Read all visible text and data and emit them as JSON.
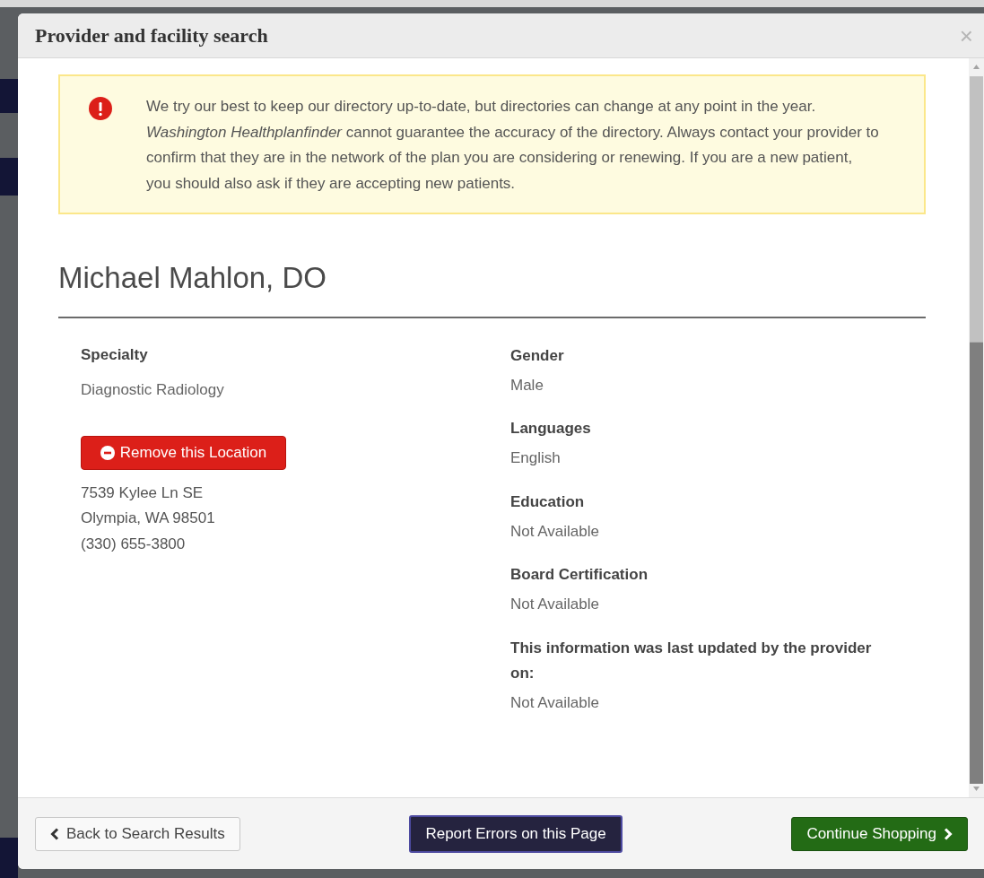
{
  "dialog": {
    "title": "Provider and facility search",
    "close": "×"
  },
  "notice": {
    "text": "We try our best to keep our directory up-to-date, but directories can change at any point in the year. *Washington Healthplanfinder* cannot guarantee the accuracy of the directory. Always contact your provider to confirm that they are in the network of the plan you are considering or renewing. If you are a new patient, you should also ask if they are accepting new patients."
  },
  "provider": {
    "name": "Michael Mahlon, DO",
    "left_fields": [
      {
        "label": "Specialty",
        "value": "Diagnostic Radiology"
      }
    ],
    "remove_button": "Remove this Location",
    "address": [
      "7539 Kylee Ln SE",
      "Olympia, WA 98501",
      "(330) 655-3800"
    ],
    "right_fields": [
      {
        "label": "Gender",
        "value": "Male"
      },
      {
        "label": "Languages",
        "value": "English"
      },
      {
        "label": "Education",
        "value": "Not Available"
      },
      {
        "label": "Board Certification",
        "value": "Not Available"
      },
      {
        "label": "This information was last updated by the provider on:",
        "value": "Not Available"
      }
    ]
  },
  "footer": {
    "back": "Back to Search Results",
    "report": "Report Errors on this Page",
    "continue": "Continue Shopping"
  }
}
